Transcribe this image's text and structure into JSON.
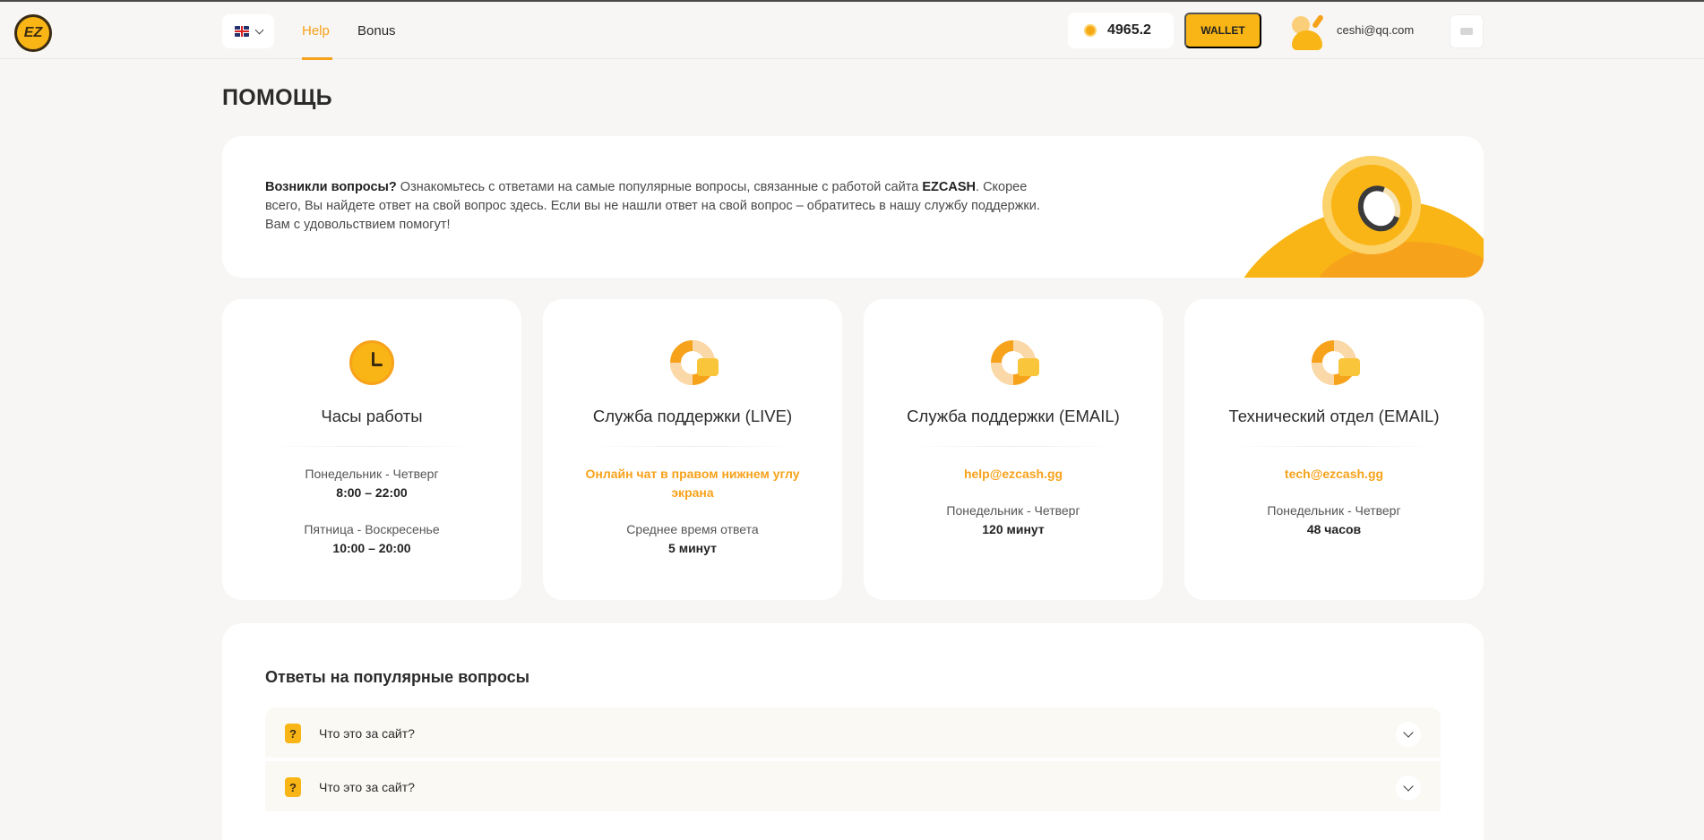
{
  "header": {
    "logo_text": "EZ",
    "nav": {
      "help": "Help",
      "bonus": "Bonus"
    },
    "balance": "4965.2",
    "wallet_label": "WALLET",
    "user_email": "ceshi@qq.com"
  },
  "page": {
    "title": "ПОМОЩЬ"
  },
  "intro": {
    "lead": "Возникли вопросы?",
    "text1": " Ознакомьтесь с ответами на самые популярные вопросы, связанные с работой сайта ",
    "brand": "EZCASH",
    "text2": ". Скорее всего, Вы найдете ответ на свой вопрос здесь. Если вы не нашли ответ на свой вопрос – обратитесь в нашу службу поддержки. Вам с удовольствием помогут!"
  },
  "cards": [
    {
      "title": "Часы работы",
      "l1": "Понедельник - Четверг",
      "l2": "8:00 – 22:00",
      "l3": "Пятница - Воскресенье",
      "l4": "10:00 – 20:00"
    },
    {
      "title": "Служба поддержки (LIVE)",
      "l1": "Онлайн чат в правом нижнем углу экрана",
      "l3": "Среднее время ответа",
      "l4": "5 минут"
    },
    {
      "title": "Служба поддержки (EMAIL)",
      "l1": "help@ezcash.gg",
      "l3": "Понедельник - Четверг",
      "l4": "120 минут"
    },
    {
      "title": "Технический отдел (EMAIL)",
      "l1": "tech@ezcash.gg",
      "l3": "Понедельник - Четверг",
      "l4": "48 часов"
    }
  ],
  "faq": {
    "title": "Ответы на популярные вопросы",
    "items": [
      {
        "question": "Что это за сайт?"
      },
      {
        "question": "Что это за сайт?"
      }
    ]
  },
  "colors": {
    "accent": "#f9b515",
    "accent_text": "#f7a21b",
    "background": "#f7f6f4"
  },
  "icons": [
    "clock-icon",
    "lifebuoy-chat-icon",
    "lifebuoy-mail-icon",
    "question-icon",
    "chevron-down-icon",
    "logout-icon",
    "coin-icon",
    "flag-uk-icon"
  ]
}
